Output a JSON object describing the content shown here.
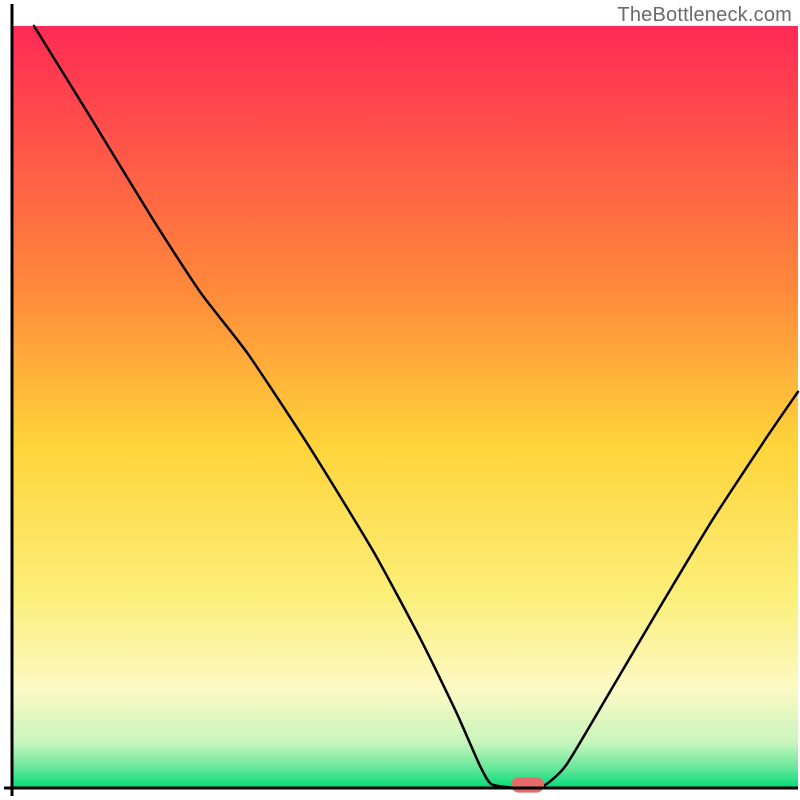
{
  "branding": {
    "watermark": "TheBottleneck.com"
  },
  "chart_data": {
    "type": "line",
    "title": "",
    "xlabel": "",
    "ylabel": "",
    "x_range": [
      0,
      100
    ],
    "y_range": [
      0,
      100
    ],
    "gradient": {
      "stops": [
        {
          "offset": 0.0,
          "color": "#ff2a55"
        },
        {
          "offset": 0.35,
          "color": "#ff8a3a"
        },
        {
          "offset": 0.55,
          "color": "#ffd43a"
        },
        {
          "offset": 0.75,
          "color": "#fbef7a"
        },
        {
          "offset": 0.87,
          "color": "#fdf9c4"
        },
        {
          "offset": 0.94,
          "color": "#c9f5bd"
        },
        {
          "offset": 0.974,
          "color": "#67e79b"
        },
        {
          "offset": 1.0,
          "color": "#00db79"
        }
      ]
    },
    "axis": {
      "color": "#000000",
      "width": 3
    },
    "curve": {
      "color": "#000000",
      "width": 2.5,
      "points": [
        {
          "x": 2.8,
          "y": 100.0
        },
        {
          "x": 10.0,
          "y": 88.0
        },
        {
          "x": 18.0,
          "y": 74.5
        },
        {
          "x": 24.0,
          "y": 65.0
        },
        {
          "x": 30.0,
          "y": 57.0
        },
        {
          "x": 38.0,
          "y": 44.5
        },
        {
          "x": 46.0,
          "y": 31.0
        },
        {
          "x": 52.0,
          "y": 19.5
        },
        {
          "x": 56.5,
          "y": 10.0
        },
        {
          "x": 59.5,
          "y": 3.0
        },
        {
          "x": 61.0,
          "y": 0.5
        },
        {
          "x": 64.5,
          "y": 0.0
        },
        {
          "x": 67.5,
          "y": 0.2
        },
        {
          "x": 70.5,
          "y": 3.0
        },
        {
          "x": 76.0,
          "y": 12.5
        },
        {
          "x": 82.0,
          "y": 23.0
        },
        {
          "x": 89.0,
          "y": 35.0
        },
        {
          "x": 96.0,
          "y": 46.0
        },
        {
          "x": 100.0,
          "y": 52.0
        }
      ]
    },
    "marker": {
      "x": 65.6,
      "y": 0.4,
      "rx": 2.1,
      "ry": 1.0,
      "color": "#e96a6a"
    }
  }
}
